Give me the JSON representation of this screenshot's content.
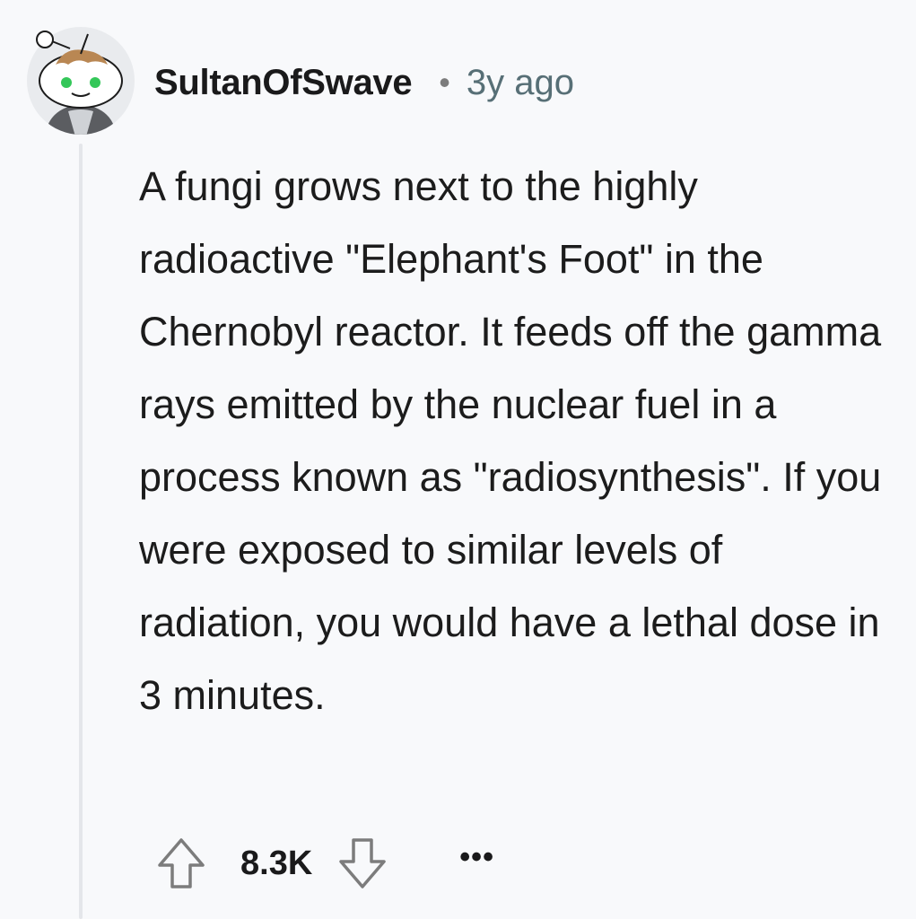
{
  "comment": {
    "author": "SultanOfSwave",
    "separator": "•",
    "timestamp": "3y ago",
    "body": "A fungi grows next to the highly radioactive \"Elephant's Foot\" in the Chernobyl reactor. It feeds off the gamma rays emitted by the nuclear fuel in a process known as \"radiosynthesis\". If you were exposed to similar levels of radiation, you would have a lethal dose in 3 minutes.",
    "score": "8.3K",
    "more_label": "•••"
  },
  "icons": {
    "avatar": "snoo-avatar-icon",
    "upvote": "arrow-up-icon",
    "downvote": "arrow-down-icon",
    "more": "ellipsis-icon"
  },
  "colors": {
    "background": "#f8f9fb",
    "text": "#1c1c1c",
    "meta": "#576f76",
    "thread_line": "#e4e6ea"
  }
}
